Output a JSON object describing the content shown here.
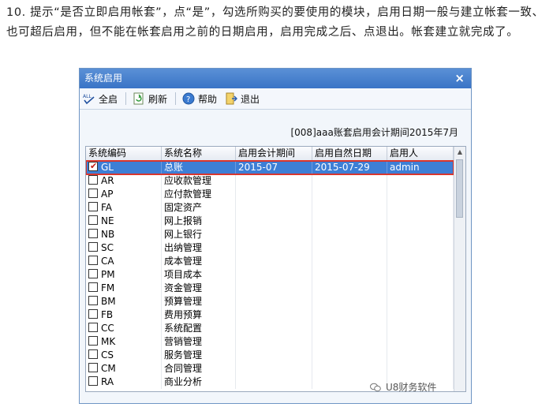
{
  "instruction": {
    "text": "10. 提示“是否立即启用帐套”，点“是”，勾选所购买的要使用的模块，启用日期一般与建立帐套一致、也可超后启用，但不能在帐套启用之前的日期启用，启用完成之后、点退出。帐套建立就完成了。"
  },
  "dialog": {
    "title": "系统启用",
    "close_label": "×",
    "toolbar": {
      "select_all_icon_text": "ALL",
      "select_all": "全启",
      "refresh": "刷新",
      "help": "帮助",
      "exit": "退出"
    },
    "period_label": "[008]aaa账套启用会计期间2015年7月",
    "columns": [
      "系统编码",
      "系统名称",
      "启用会计期间",
      "启用自然日期",
      "启用人"
    ],
    "rows": [
      {
        "code": "GL",
        "name": "总账",
        "period": "2015-07",
        "date": "2015-07-29",
        "user": "admin",
        "checked": true,
        "selected": true
      },
      {
        "code": "AR",
        "name": "应收款管理",
        "period": "",
        "date": "",
        "user": "",
        "checked": false
      },
      {
        "code": "AP",
        "name": "应付款管理",
        "period": "",
        "date": "",
        "user": "",
        "checked": false
      },
      {
        "code": "FA",
        "name": "固定资产",
        "period": "",
        "date": "",
        "user": "",
        "checked": false
      },
      {
        "code": "NE",
        "name": "网上报销",
        "period": "",
        "date": "",
        "user": "",
        "checked": false
      },
      {
        "code": "NB",
        "name": "网上银行",
        "period": "",
        "date": "",
        "user": "",
        "checked": false
      },
      {
        "code": "SC",
        "name": "出纳管理",
        "period": "",
        "date": "",
        "user": "",
        "checked": false
      },
      {
        "code": "CA",
        "name": "成本管理",
        "period": "",
        "date": "",
        "user": "",
        "checked": false
      },
      {
        "code": "PM",
        "name": "项目成本",
        "period": "",
        "date": "",
        "user": "",
        "checked": false
      },
      {
        "code": "FM",
        "name": "资金管理",
        "period": "",
        "date": "",
        "user": "",
        "checked": false
      },
      {
        "code": "BM",
        "name": "预算管理",
        "period": "",
        "date": "",
        "user": "",
        "checked": false
      },
      {
        "code": "FB",
        "name": "费用预算",
        "period": "",
        "date": "",
        "user": "",
        "checked": false
      },
      {
        "code": "CC",
        "name": "系统配置",
        "period": "",
        "date": "",
        "user": "",
        "checked": false
      },
      {
        "code": "MK",
        "name": "营销管理",
        "period": "",
        "date": "",
        "user": "",
        "checked": false
      },
      {
        "code": "CS",
        "name": "服务管理",
        "period": "",
        "date": "",
        "user": "",
        "checked": false
      },
      {
        "code": "CM",
        "name": "合同管理",
        "period": "",
        "date": "",
        "user": "",
        "checked": false
      },
      {
        "code": "RA",
        "name": "商业分析",
        "period": "",
        "date": "",
        "user": "",
        "checked": false
      }
    ]
  },
  "watermark": {
    "text": "U8财务软件"
  },
  "colors": {
    "titlebar": "#3a74c6",
    "selected_row": "#3d7fd6",
    "highlight_border": "#d9362e"
  }
}
